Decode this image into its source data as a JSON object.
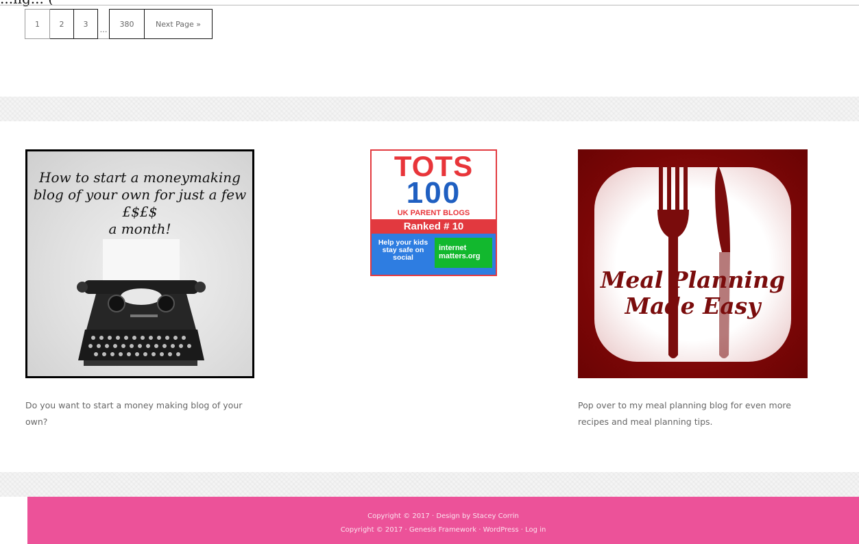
{
  "top_partial_text": "...ng... (",
  "pagination": {
    "pages": [
      "1",
      "2",
      "3"
    ],
    "ellipsis": "…",
    "last_page": "380",
    "next_label": "Next Page »"
  },
  "widgets": {
    "moneymaking": {
      "headline_lines": [
        "How to start a moneymaking",
        "blog of your own for just a few",
        "£$£$",
        "a month!"
      ],
      "caption": "Do you want to start a money making blog of your own?"
    },
    "tots": {
      "line1": "TOTS",
      "line2": "100",
      "line3": "UK PARENT BLOGS",
      "rank": "Ranked # 10",
      "help": "Help your kids stay safe on social",
      "partner": "internet matters.org",
      "colors": {
        "red": "#e2393f",
        "blue": "#2e7de1",
        "green": "#12b82e"
      }
    },
    "meal": {
      "title_lines": [
        "Meal Planning",
        "Made Easy"
      ],
      "caption": "Pop over to my meal planning blog for even more recipes and meal planning tips."
    }
  },
  "footer": {
    "line1": "Copyright © 2017 · Design by Stacey Corrin",
    "line2_prefix": "Copyright © 2017 · ",
    "link_genesis": "Genesis Framework",
    "sep1": " · ",
    "link_wordpress": "WordPress",
    "sep2": " · ",
    "link_login": "Log in",
    "bg_color": "#ec5299"
  }
}
